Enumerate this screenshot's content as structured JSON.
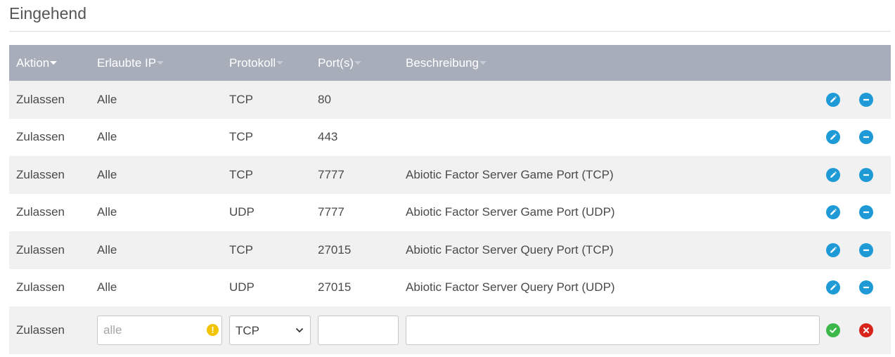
{
  "section": {
    "title": "Eingehend"
  },
  "table": {
    "headers": [
      {
        "label": "Aktion",
        "sorted": true
      },
      {
        "label": "Erlaubte IP",
        "sorted": false
      },
      {
        "label": "Protokoll",
        "sorted": false
      },
      {
        "label": "Port(s)",
        "sorted": false
      },
      {
        "label": "Beschreibung",
        "sorted": false
      }
    ],
    "rows": [
      {
        "aktion": "Zulassen",
        "ip": "Alle",
        "protokoll": "TCP",
        "ports": "80",
        "beschreibung": ""
      },
      {
        "aktion": "Zulassen",
        "ip": "Alle",
        "protokoll": "TCP",
        "ports": "443",
        "beschreibung": ""
      },
      {
        "aktion": "Zulassen",
        "ip": "Alle",
        "protokoll": "TCP",
        "ports": "7777",
        "beschreibung": "Abiotic Factor Server Game Port (TCP)"
      },
      {
        "aktion": "Zulassen",
        "ip": "Alle",
        "protokoll": "UDP",
        "ports": "7777",
        "beschreibung": "Abiotic Factor Server Game Port (UDP)"
      },
      {
        "aktion": "Zulassen",
        "ip": "Alle",
        "protokoll": "TCP",
        "ports": "27015",
        "beschreibung": "Abiotic Factor Server Query Port (TCP)"
      },
      {
        "aktion": "Zulassen",
        "ip": "Alle",
        "protokoll": "UDP",
        "ports": "27015",
        "beschreibung": "Abiotic Factor Server Query Port (UDP)"
      }
    ],
    "new_row": {
      "aktion": "Zulassen",
      "ip_placeholder": "alle",
      "ip_value": "",
      "protokoll_selected": "TCP",
      "ports_value": "",
      "beschreibung_value": ""
    }
  },
  "icons": {
    "edit": "pencil-icon",
    "delete": "minus-circle-icon",
    "confirm": "check-circle-icon",
    "cancel": "x-circle-icon",
    "warning": "exclamation-circle-icon",
    "select": "chevron-down-icon"
  },
  "colors": {
    "header_bg": "#a8adba",
    "row_alt_bg": "#f1f1f1",
    "action_blue": "#1e9bd7",
    "confirm_green": "#3cb84b",
    "cancel_red": "#d9241e",
    "warning_yellow": "#f2c300"
  }
}
